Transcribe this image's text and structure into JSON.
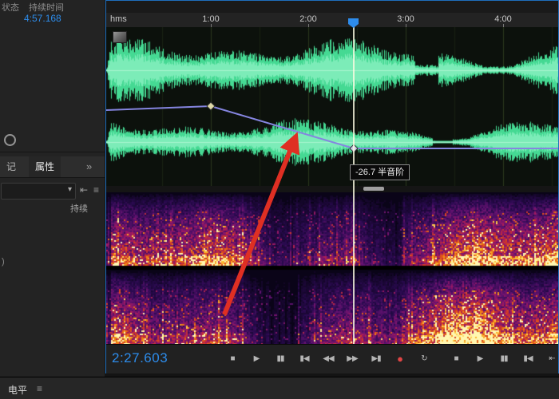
{
  "left_panel": {
    "status_label": "状态",
    "duration_header": "持续时间",
    "duration_value": "4:57.168",
    "tabs": {
      "markers": "记",
      "properties": "属性",
      "overflow": "»"
    },
    "combo_chevron": "▾",
    "collapse_icon": "⇤",
    "menu_icon": "≡",
    "duration_row_label": "持续",
    "truncated_text": ")"
  },
  "editor": {
    "ruler": {
      "unit": "hms",
      "ticks": [
        "1:00",
        "2:00",
        "3:00",
        "4:00"
      ]
    },
    "envelope_tooltip": "-26.7 半音阶",
    "transport": {
      "time": "2:27.603",
      "main_buttons": [
        {
          "name": "stop",
          "glyph": "■"
        },
        {
          "name": "play",
          "glyph": "▶"
        },
        {
          "name": "pause",
          "glyph": "▮▮"
        },
        {
          "name": "previous",
          "glyph": "▮◀"
        },
        {
          "name": "rewind",
          "glyph": "◀◀"
        },
        {
          "name": "fast-forward",
          "glyph": "▶▶"
        },
        {
          "name": "next",
          "glyph": "▶▮"
        },
        {
          "name": "record",
          "glyph": "●"
        },
        {
          "name": "loop",
          "glyph": "↻"
        }
      ],
      "right_buttons": [
        {
          "name": "stop-alt",
          "glyph": "■"
        },
        {
          "name": "play-alt",
          "glyph": "▶"
        },
        {
          "name": "pause-alt",
          "glyph": "▮▮"
        },
        {
          "name": "skip-to-start",
          "glyph": "▮◀"
        },
        {
          "name": "go-to-beginning",
          "glyph": "⇤"
        }
      ]
    }
  },
  "bottom_panel": {
    "title": "电平",
    "menu_glyph": "≡"
  },
  "colors": {
    "accent_blue": "#2d8ceb",
    "waveform_green": "#45d993",
    "waveform_green_light": "#7cecb8",
    "envelope_purple": "#8585e0",
    "record_red": "#e04545",
    "arrow_red": "#df2f23",
    "playhead": "#f5f5e0"
  }
}
